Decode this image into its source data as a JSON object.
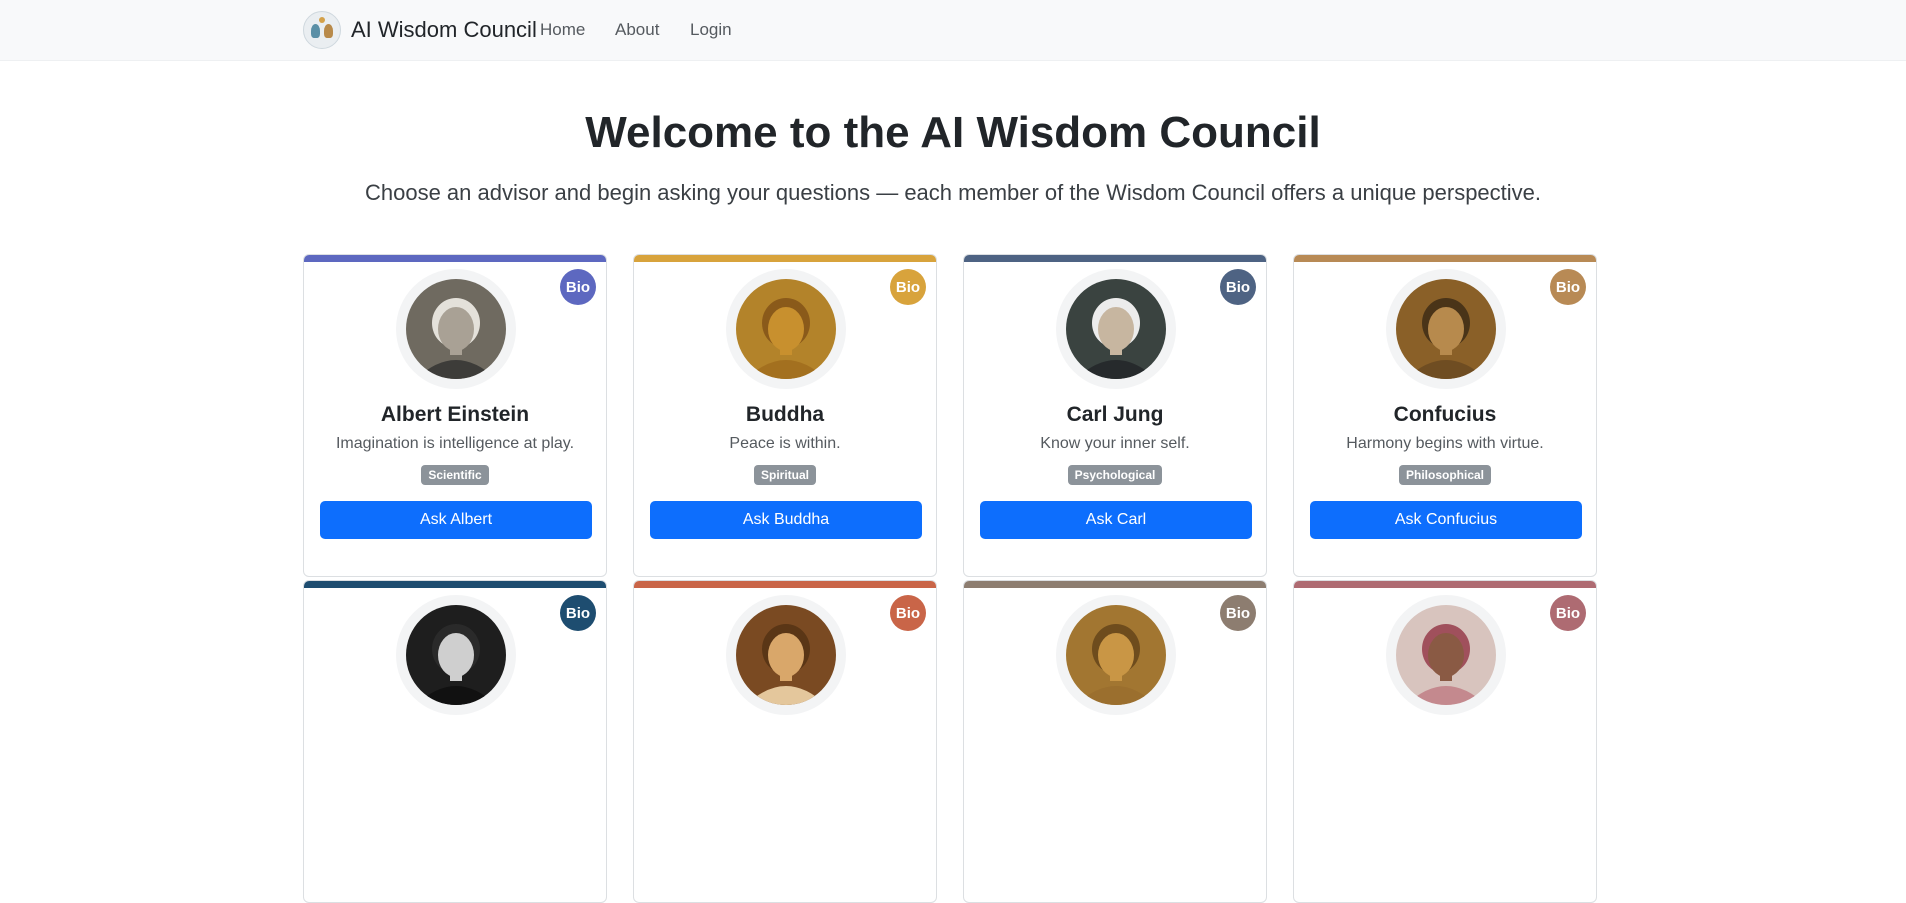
{
  "navbar": {
    "brand": "AI Wisdom Council",
    "links": [
      "Home",
      "About",
      "Login"
    ]
  },
  "hero": {
    "title": "Welcome to the AI Wisdom Council",
    "subtitle": "Choose an advisor and begin asking your questions — each member of the Wisdom Council offers a unique perspective."
  },
  "advisors": [
    {
      "name": "Albert Einstein",
      "quote": "Imagination is intelligence at play.",
      "tag": "Scientific",
      "button": "Ask Albert",
      "bio": "Bio",
      "accent": "#5d68c0",
      "skin": "#a9a195",
      "bg": "#6f6a60",
      "hair": "#e4e1da",
      "robe": "#3d3c39"
    },
    {
      "name": "Buddha",
      "quote": "Peace is within.",
      "tag": "Spiritual",
      "button": "Ask Buddha",
      "bio": "Bio",
      "accent": "#d8a33c",
      "skin": "#c8902e",
      "bg": "#b3832a",
      "hair": "#8a5a1a",
      "robe": "#a3701f"
    },
    {
      "name": "Carl Jung",
      "quote": "Know your inner self.",
      "tag": "Psychological",
      "button": "Ask Carl",
      "bio": "Bio",
      "accent": "#4e6383",
      "skin": "#c7b6a0",
      "bg": "#3a4340",
      "hair": "#ececec",
      "robe": "#262a2c"
    },
    {
      "name": "Confucius",
      "quote": "Harmony begins with virtue.",
      "tag": "Philosophical",
      "button": "Ask Confucius",
      "bio": "Bio",
      "accent": "#b88a55",
      "skin": "#b78a4d",
      "bg": "#8a6028",
      "hair": "#4a3418",
      "robe": "#6f4d22"
    },
    {
      "name": "",
      "quote": "",
      "tag": "",
      "button": "",
      "bio": "Bio",
      "accent": "#1e4d70",
      "skin": "#cfcfcf",
      "bg": "#1e1e1e",
      "hair": "#2a2a2a",
      "robe": "#111111"
    },
    {
      "name": "",
      "quote": "",
      "tag": "",
      "button": "",
      "bio": "Bio",
      "accent": "#c96548",
      "skin": "#d9a76a",
      "bg": "#7a4a22",
      "hair": "#5a3616",
      "robe": "#e4c79c"
    },
    {
      "name": "",
      "quote": "",
      "tag": "",
      "button": "",
      "bio": "Bio",
      "accent": "#8d7d70",
      "skin": "#c99645",
      "bg": "#a27631",
      "hair": "#6e4c1d",
      "robe": "#9b6f2e"
    },
    {
      "name": "",
      "quote": "",
      "tag": "",
      "button": "",
      "bio": "Bio",
      "accent": "#ae6b72",
      "skin": "#8a5a44",
      "bg": "#d8c4be",
      "hair": "#a0505c",
      "robe": "#c4898e"
    }
  ]
}
